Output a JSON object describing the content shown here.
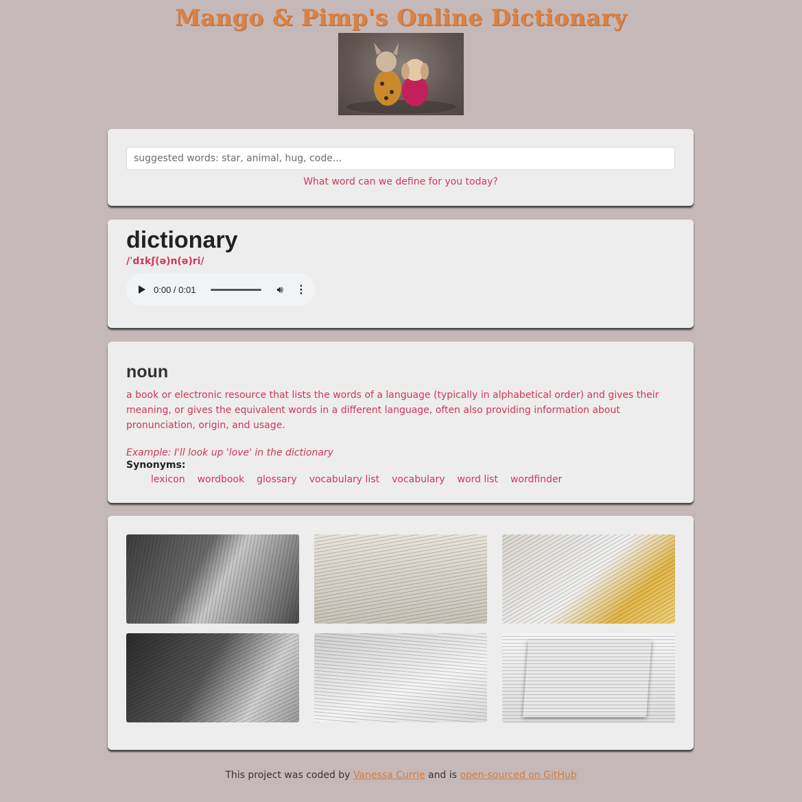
{
  "header": {
    "title": "Mango & Pimp's Online Dictionary"
  },
  "search": {
    "placeholder": "suggested words: star, animal, hug, code...",
    "prompt": "What word can we define for you today?"
  },
  "entry": {
    "word": "dictionary",
    "phonetic": "/ˈdɪkʃ(ə)n(ə)ri/",
    "audio": {
      "time": "0:00 / 0:01"
    }
  },
  "meaning": {
    "part_of_speech": "noun",
    "definition": "a book or electronic resource that lists the words of a language (typically in alphabetical order) and gives their meaning, or gives the equivalent words in a different language, often also providing information about pronunciation, origin, and usage.",
    "example": "Example: I'll look up 'love' in the dictionary",
    "synonyms_label": "Synonyms:",
    "synonyms": [
      "lexicon",
      "wordbook",
      "glossary",
      "vocabulary list",
      "vocabulary",
      "word list",
      "wordfinder"
    ]
  },
  "footer": {
    "text_1": "This project was coded by",
    "author": "Vanessa Currie",
    "text_2": "and is",
    "repo_link": "open-sourced on GitHub"
  },
  "colors": {
    "accent": "#d0355a",
    "title": "#d98245",
    "background": "#c5b8b8",
    "card": "#ededed"
  }
}
